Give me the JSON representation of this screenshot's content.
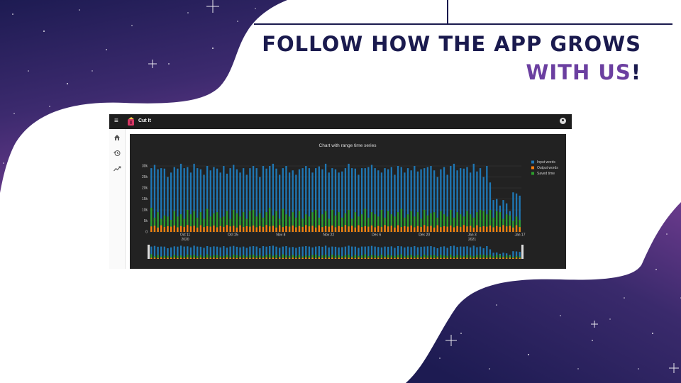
{
  "headline": {
    "line1": "FOLLOW HOW THE APP GROWS",
    "line2": "WITH US",
    "line2_suffix": "!"
  },
  "app": {
    "title": "Cut It",
    "nav": [
      {
        "icon": "home-icon"
      },
      {
        "icon": "history-icon"
      },
      {
        "icon": "trending-icon"
      }
    ]
  },
  "colors": {
    "navy": "#1a1a4e",
    "purple": "#6b3fa0",
    "input_words": "#1f77b4",
    "output_words": "#ff7f0e",
    "saved_time": "#2ca02c"
  },
  "chart_data": {
    "type": "bar",
    "title": "Chart with range time series",
    "ylim": [
      0,
      30000
    ],
    "y_ticks": [
      "0",
      "5k",
      "10k",
      "15k",
      "20k",
      "25k",
      "30k"
    ],
    "x_ticks": [
      {
        "label": "Oct 11",
        "sub": "2020"
      },
      {
        "label": "Oct 25",
        "sub": ""
      },
      {
        "label": "Nov 8",
        "sub": ""
      },
      {
        "label": "Nov 22",
        "sub": ""
      },
      {
        "label": "Dec 6",
        "sub": ""
      },
      {
        "label": "Dec 20",
        "sub": ""
      },
      {
        "label": "Jan 3",
        "sub": "2021"
      },
      {
        "label": "Jan 17",
        "sub": ""
      }
    ],
    "legend": [
      "Input words",
      "Output words",
      "Saved time"
    ],
    "legend_position": "right",
    "range_slider": true,
    "series": [
      {
        "name": "Input words",
        "values": [
          29000,
          30500,
          28500,
          29000,
          28800,
          25000,
          27000,
          29500,
          28800,
          31000,
          29000,
          29500,
          27000,
          31000,
          29000,
          28500,
          26000,
          30000,
          28000,
          29500,
          28800,
          27000,
          30000,
          26500,
          29000,
          30500,
          28500,
          27000,
          29000,
          26000,
          29000,
          30000,
          29000,
          25000,
          30000,
          28800,
          30000,
          31000,
          28800,
          26000,
          29000,
          30000,
          27000,
          28000,
          26000,
          28500,
          29000,
          30000,
          29000,
          27000,
          29000,
          29800,
          28500,
          31000,
          27000,
          29000,
          28500,
          27000,
          27500,
          29000,
          31000,
          29000,
          28800,
          26000,
          29000,
          29000,
          29500,
          30500,
          29000,
          28000,
          27000,
          29000,
          28500,
          29500,
          26000,
          30000,
          29500,
          27000,
          29000,
          28000,
          30000,
          27500,
          28500,
          29000,
          29500,
          30000,
          28000,
          25000,
          28500,
          29500,
          26000,
          30000,
          31000,
          28000,
          29000,
          28800,
          29500,
          27000,
          31000,
          27500,
          29000,
          25000,
          30000,
          22500,
          14500,
          15000,
          12000,
          14500,
          13000,
          9500,
          18000,
          17500,
          16500
        ]
      },
      {
        "name": "Output words",
        "values": [
          2500,
          2800,
          2000,
          3000,
          2200,
          2600,
          2400,
          2900,
          2100,
          2700,
          2300,
          3100,
          2500,
          2800,
          2000,
          3000,
          2200,
          2600,
          2400,
          2900,
          2100,
          2700,
          2300,
          3100,
          2500,
          2800,
          2000,
          3000,
          2200,
          2600,
          2400,
          2900,
          2100,
          2700,
          2300,
          3100,
          2500,
          2800,
          2000,
          3000,
          2200,
          2600,
          2400,
          2900,
          2100,
          2700,
          2300,
          3100,
          2500,
          2800,
          2000,
          3000,
          2200,
          2600,
          2400,
          2900,
          2100,
          2700,
          2300,
          3100,
          2500,
          2800,
          2000,
          3000,
          2200,
          2600,
          2400,
          2900,
          2100,
          2700,
          2300,
          3100,
          2500,
          2800,
          2000,
          3000,
          2200,
          2600,
          2400,
          2900,
          2100,
          2700,
          2300,
          3100,
          2500,
          2800,
          2000,
          3000,
          2200,
          2600,
          2400,
          2900,
          2100,
          2700,
          2300,
          3100,
          2500,
          2800,
          2000,
          3000,
          2200,
          2600,
          2400,
          2900,
          2100,
          2700,
          2300,
          3100,
          2500,
          2800,
          2000,
          3000,
          2200
        ]
      },
      {
        "name": "Saved time",
        "values": [
          11000,
          6500,
          9000,
          6000,
          7500,
          7000,
          5500,
          9500,
          7000,
          8000,
          6000,
          10000,
          8000,
          9500,
          6500,
          9000,
          6000,
          10500,
          7000,
          8500,
          9000,
          6500,
          7000,
          9500,
          6000,
          10000,
          8500,
          7000,
          9000,
          6000,
          9500,
          10000,
          7000,
          8500,
          6500,
          9000,
          11000,
          7500,
          9500,
          6000,
          10500,
          8000,
          7000,
          9000,
          6500,
          9500,
          6000,
          8000,
          7000,
          9000,
          10000,
          6500,
          8000,
          9500,
          6000,
          10000,
          7500,
          9000,
          6500,
          8500,
          10000,
          6000,
          9000,
          7000,
          8000,
          10500,
          6500,
          9000,
          8000,
          7000,
          10000,
          6500,
          9500,
          8000,
          7000,
          9000,
          10500,
          6500,
          8000,
          9500,
          7000,
          9000,
          6000,
          10000,
          7500,
          8500,
          9000,
          6500,
          9500,
          8000,
          7000,
          10000,
          6500,
          9000,
          8000,
          7000,
          9500,
          8000,
          6500,
          9000,
          10000,
          9500,
          8000,
          10000,
          6500,
          9500,
          9000,
          6000,
          8000,
          7500,
          5000,
          7000,
          5500
        ]
      }
    ]
  }
}
